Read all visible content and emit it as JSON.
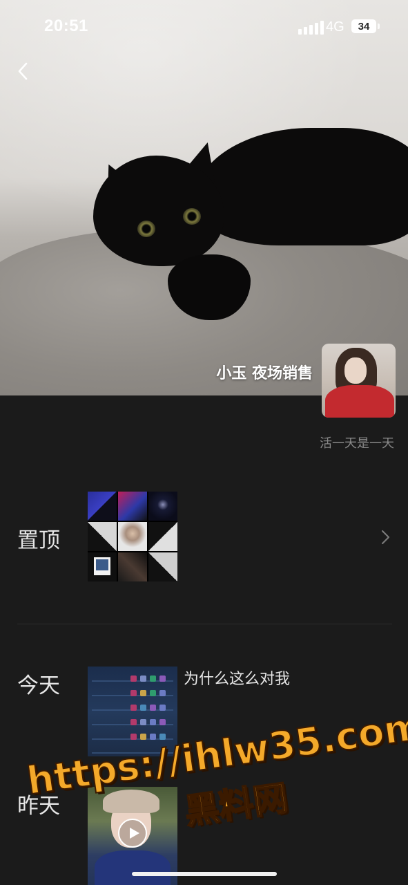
{
  "status_bar": {
    "time": "20:51",
    "network": "4G",
    "battery": "34"
  },
  "profile": {
    "nickname": "小玉 夜场销售",
    "signature": "活一天是一天"
  },
  "moments": {
    "pinned": {
      "label": "置顶"
    },
    "today": {
      "label": "今天",
      "text": "为什么这么对我"
    },
    "yesterday": {
      "label": "昨天"
    }
  },
  "watermark": {
    "url": "https://ihlw35.com",
    "name": "黑料网"
  },
  "colors": {
    "background": "#1b1b1b",
    "text_primary": "#e6e6e6",
    "text_secondary": "#8a8a8a",
    "watermark": "#f4a92a"
  },
  "icons": [
    "back-icon",
    "chevron-right-icon",
    "play-icon",
    "signal-icon",
    "battery-icon"
  ]
}
